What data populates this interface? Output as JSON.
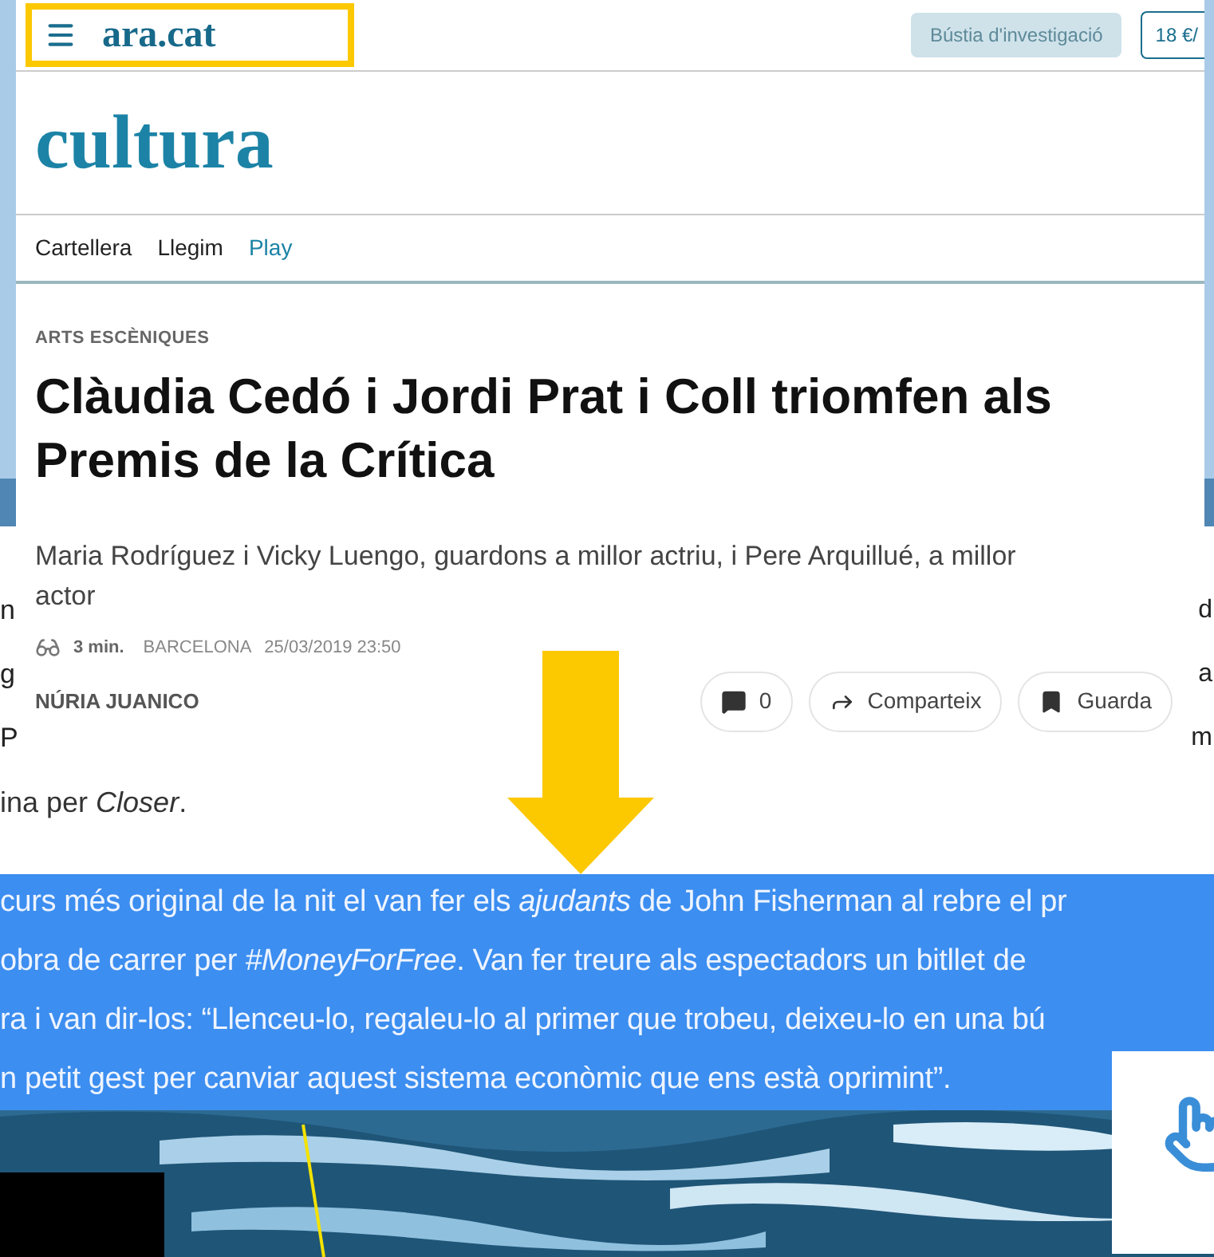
{
  "header": {
    "logo": "ara.cat",
    "buttons": [
      {
        "label": "Bústia d'investigació",
        "kind": "filled"
      },
      {
        "label": "18 €/",
        "kind": "outline"
      }
    ]
  },
  "section_title": "cultura",
  "section_nav": [
    {
      "label": "Cartellera",
      "selected": false
    },
    {
      "label": "Llegim",
      "selected": false
    },
    {
      "label": "Play",
      "selected": true
    }
  ],
  "article": {
    "category": "ARTS ESCÈNIQUES",
    "headline": "Clàudia Cedó i Jordi Prat i Coll triomfen als Premis de la Crítica",
    "subtitle": "Maria Rodríguez i Vicky Luengo, guardons a millor actriu, i Pere Arquillué, a millor actor",
    "reading_time": "3 min.",
    "location": "BARCELONA",
    "datetime": "25/03/2019 23:50",
    "author": "NÚRIA JUANICO",
    "actions": [
      {
        "label": "0",
        "kind": "comment"
      },
      {
        "label": "Comparteix",
        "kind": "share"
      },
      {
        "label": "Guarda",
        "kind": "save"
      }
    ]
  },
  "background_text": {
    "left_fragments": [
      "n",
      "g",
      "P"
    ],
    "right_fragments": [
      "d",
      "a",
      "m"
    ],
    "line": "ina per *Closer*."
  },
  "selected_text": {
    "lines": [
      "curs més original de la nit el van fer els *ajudants* de John Fisherman al rebre el pr",
      "obra de carrer per *#MoneyForFree*. Van fer treure als espectadors un bitllet de",
      "ra i van dir-los: “Llenceu-lo, regaleu-lo al primer que trobeu, deixeu-lo en una bú",
      "n petit gest per canviar aquest sistema econòmic que ens està oprimint”."
    ]
  }
}
